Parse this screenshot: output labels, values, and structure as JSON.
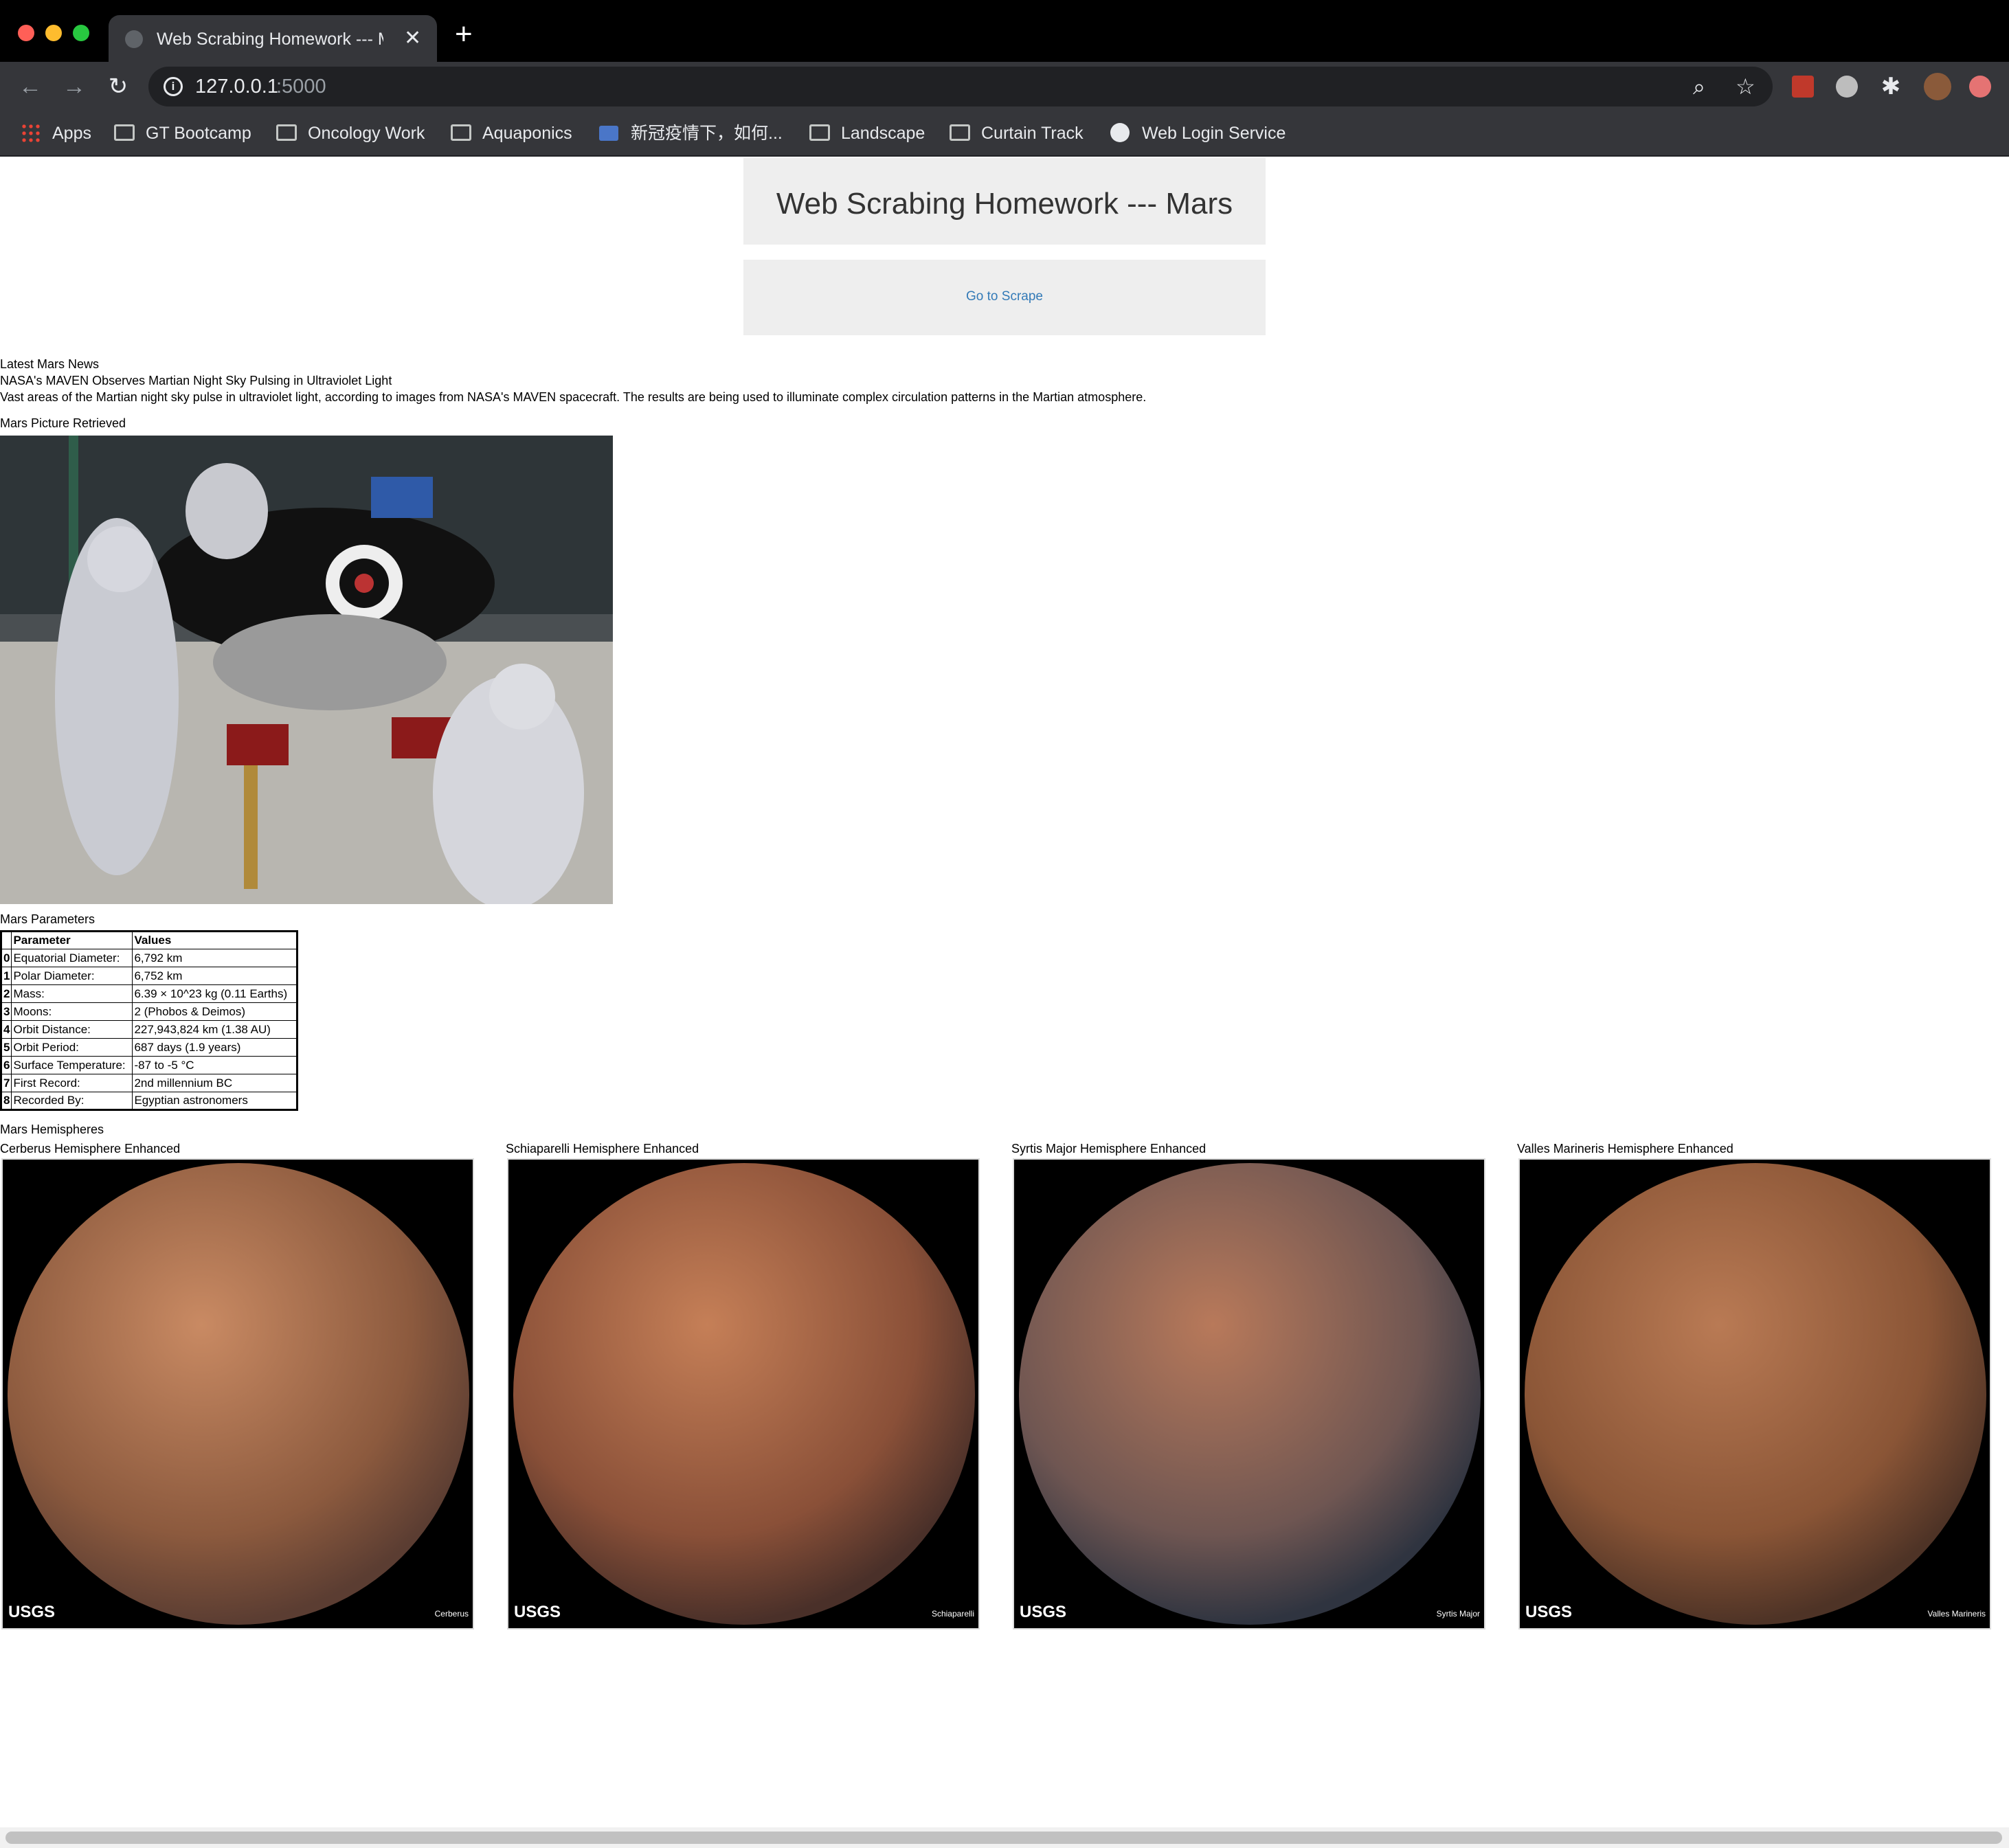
{
  "browser": {
    "tab_title": "Web Scrabing Homework --- Mars",
    "url_host": "127.0.0.1",
    "url_port": ":5000",
    "bookmarks": [
      "Apps",
      "GT Bootcamp",
      "Oncology Work",
      "Aquaponics",
      "新冠疫情下，如何...",
      "Landscape",
      "Curtain Track",
      "Web Login Service"
    ]
  },
  "page": {
    "title": "Web Scrabing Homework --- Mars",
    "scrape_link": "Go to Scrape"
  },
  "news": {
    "heading": "Latest Mars News",
    "title": "NASA's MAVEN Observes Martian Night Sky Pulsing in Ultraviolet Light",
    "paragraph": "Vast areas of the Martian night sky pulse in ultraviolet light, according to images from NASA's MAVEN spacecraft. The results are being used to illuminate complex circulation patterns in the Martian atmosphere."
  },
  "picture": {
    "heading": "Mars Picture Retrieved"
  },
  "facts": {
    "heading": "Mars Parameters",
    "columns": [
      "",
      "Parameter",
      "Values"
    ],
    "rows": [
      {
        "index": "0",
        "parameter": "Equatorial Diameter:",
        "value": "6,792 km"
      },
      {
        "index": "1",
        "parameter": "Polar Diameter:",
        "value": "6,752 km"
      },
      {
        "index": "2",
        "parameter": "Mass:",
        "value": "6.39 × 10^23 kg (0.11 Earths)"
      },
      {
        "index": "3",
        "parameter": "Moons:",
        "value": "2 (Phobos & Deimos)"
      },
      {
        "index": "4",
        "parameter": "Orbit Distance:",
        "value": "227,943,824 km (1.38 AU)"
      },
      {
        "index": "5",
        "parameter": "Orbit Period:",
        "value": "687 days (1.9 years)"
      },
      {
        "index": "6",
        "parameter": "Surface Temperature:",
        "value": "-87 to -5 °C"
      },
      {
        "index": "7",
        "parameter": "First Record:",
        "value": "2nd millennium BC"
      },
      {
        "index": "8",
        "parameter": "Recorded By:",
        "value": "Egyptian astronomers"
      }
    ]
  },
  "hemispheres": {
    "heading": "Mars Hemispheres",
    "items": [
      {
        "title": "Cerberus Hemisphere Enhanced",
        "caption": "Cerberus",
        "logo": "USGS"
      },
      {
        "title": "Schiaparelli Hemisphere Enhanced",
        "caption": "Schiaparelli",
        "logo": "USGS"
      },
      {
        "title": "Syrtis Major Hemisphere Enhanced",
        "caption": "Syrtis Major",
        "logo": "USGS"
      },
      {
        "title": "Valles Marineris Hemisphere Enhanced",
        "caption": "Valles Marineris",
        "logo": "USGS"
      }
    ]
  },
  "colors": {
    "chrome_dark": "#202124",
    "link": "#337ab7",
    "jumbotron": "#eeeeee"
  }
}
